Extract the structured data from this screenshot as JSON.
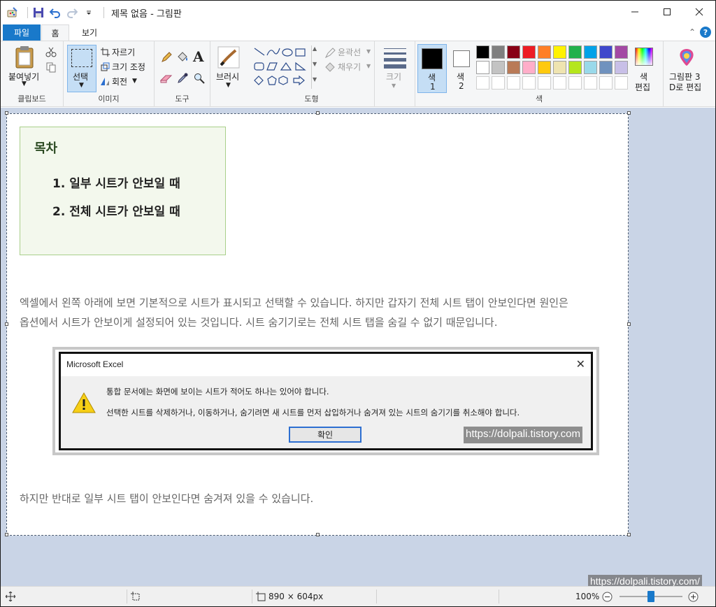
{
  "window": {
    "title": "제목 없음 - 그림판"
  },
  "tabs": [
    {
      "label": "파일"
    },
    {
      "label": "홈"
    },
    {
      "label": "보기"
    }
  ],
  "ribbon": {
    "clipboard": {
      "paste": "붙여넣기",
      "group": "클립보드"
    },
    "image": {
      "select": "선택",
      "crop": "자르기",
      "resize": "크기 조정",
      "rotate": "회전",
      "group": "이미지"
    },
    "tools": {
      "group": "도구",
      "text_glyph": "A"
    },
    "brush": {
      "label": "브러시"
    },
    "shapes": {
      "outline": "윤곽선",
      "fill": "채우기",
      "group": "도형"
    },
    "size": {
      "label": "크기"
    },
    "colors": {
      "color1_label": "색",
      "color1_num": "1",
      "color2_label": "색",
      "color2_num": "2",
      "edit_label": "색",
      "edit_label2": "편집",
      "group": "색",
      "color1": "#000000",
      "color2": "#ffffff",
      "palette_row1": [
        "#000000",
        "#7f7f7f",
        "#880015",
        "#ed1c24",
        "#ff7f27",
        "#fff200",
        "#22b14c",
        "#00a2e8",
        "#3f48cc",
        "#a349a4"
      ],
      "palette_row2": [
        "#ffffff",
        "#c3c3c3",
        "#b97a57",
        "#ffaec9",
        "#ffc90e",
        "#efe4b0",
        "#b5e61d",
        "#99d9ea",
        "#7092be",
        "#c8bfe7"
      ],
      "palette_row3": [
        "#ffffff",
        "#ffffff",
        "#ffffff",
        "#ffffff",
        "#ffffff",
        "#ffffff",
        "#ffffff",
        "#ffffff",
        "#ffffff",
        "#ffffff"
      ]
    },
    "paint3d": {
      "label1": "그림판 3",
      "label2": "D로 편집"
    }
  },
  "canvas": {
    "toc": {
      "title": "목차",
      "items": [
        "1. 일부 시트가 안보일 때",
        "2. 전체 시트가 안보일 때"
      ]
    },
    "para1_line1": "엑셀에서 왼쪽 아래에 보면 기본적으로 시트가 표시되고 선택할 수 있습니다. 하지만 갑자기 전체 시트 탭이 안보인다면 원인은",
    "para1_line2": "옵션에서 시트가 안보이게 설정되어 있는 것입니다. 시트 숨기기로는 전체 시트 탭을 숨길 수 없기 때문입니다.",
    "dialog": {
      "title": "Microsoft Excel",
      "message1": "통합 문서에는 화면에 보이는 시트가 적어도 하나는 있어야 합니다.",
      "message2": "선택한 시트를 삭제하거나, 이동하거나, 숨기려면 새 시트를 먼저 삽입하거나 숨겨져 있는 시트의 숨기기를 취소해야 합니다.",
      "ok": "확인",
      "watermark": "https://dolpali.tistory.com"
    },
    "para2": "하지만 반대로 일부 시트 탭이 안보인다면 숨겨져 있을 수 있습니다."
  },
  "statusbar": {
    "dimensions": "890 × 604px",
    "zoom": "100%",
    "zoom_level": 100,
    "watermark": "https://dolpali.tistory.com/"
  }
}
